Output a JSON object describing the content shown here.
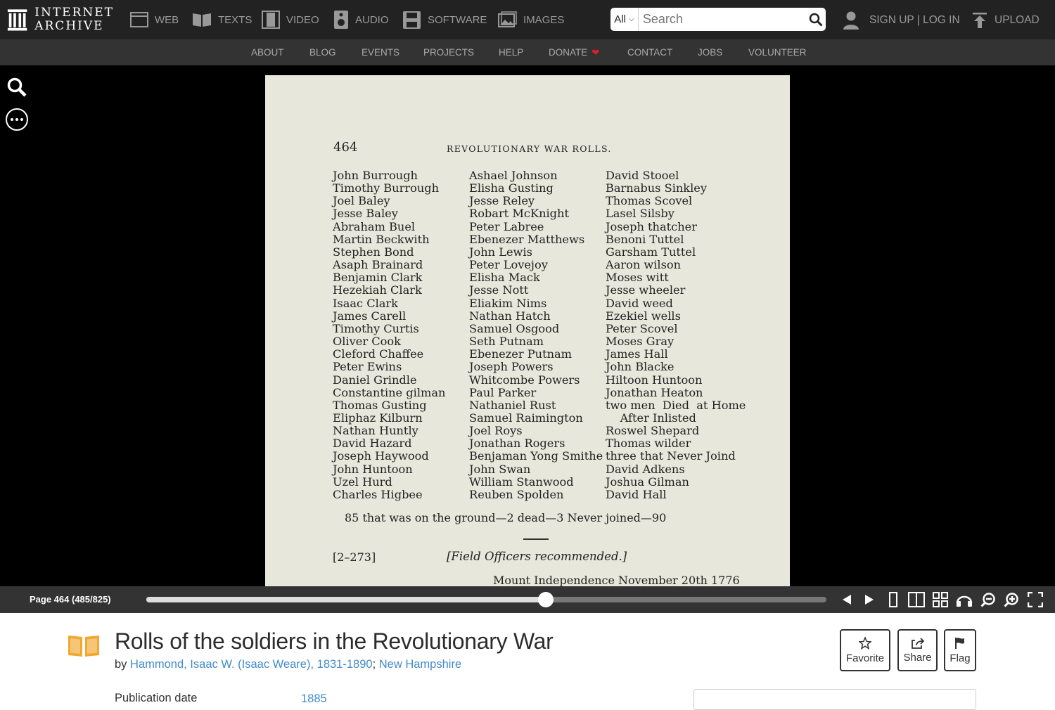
{
  "header": {
    "logo_line1": "INTERNET",
    "logo_line2": "ARCHIVE",
    "media_nav": [
      "WEB",
      "TEXTS",
      "VIDEO",
      "AUDIO",
      "SOFTWARE",
      "IMAGES"
    ],
    "search": {
      "scope": "All",
      "placeholder": "Search"
    },
    "signup_label": "SIGN UP | LOG IN",
    "upload_label": "UPLOAD"
  },
  "subnav": [
    "ABOUT",
    "BLOG",
    "EVENTS",
    "PROJECTS",
    "HELP",
    "DONATE",
    "CONTACT",
    "JOBS",
    "VOLUNTEER"
  ],
  "page": {
    "number": "464",
    "header": "REVOLUTIONARY WAR ROLLS.",
    "col1": [
      "John Burrough",
      "Timothy Burrough",
      "Joel Baley",
      "Jesse Baley",
      "Abraham Buel",
      "Martin Beckwith",
      "Stephen Bond",
      "Asaph Brainard",
      "Benjamin Clark",
      "Hezekiah Clark",
      "Isaac Clark",
      "James Carell",
      "Timothy Curtis",
      "Oliver Cook",
      "Cleford Chaffee",
      "Peter Ewins",
      "Daniel Grindle",
      "Constantine gilman",
      "Thomas Gusting",
      "Eliphaz Kilburn",
      "Nathan Huntly",
      "David Hazard",
      "Joseph Haywood",
      "John Huntoon",
      "Uzel Hurd",
      "Charles Higbee"
    ],
    "col2": [
      "Ashael Johnson",
      "Elisha Gusting",
      "Jesse Reley",
      "Robart McKnight",
      "Peter Labree",
      "Ebenezer Matthews",
      "John Lewis",
      "Peter Lovejoy",
      "Elisha Mack",
      "Jesse Nott",
      "Eliakim Nims",
      "Nathan Hatch",
      "Samuel Osgood",
      "Seth Putnam",
      "Ebenezer Putnam",
      "Joseph Powers",
      "Whitcombe Powers",
      "Paul Parker",
      "Nathaniel Rust",
      "Samuel Raimington",
      "Joel Roys",
      "Jonathan Rogers",
      "Benjaman Yong Smithe",
      "John Swan",
      "William Stanwood",
      "Reuben Spolden"
    ],
    "col3": [
      "David Stooel",
      "Barnabus Sinkley",
      "Thomas Scovel",
      "Lasel Silsby",
      "Joseph thatcher",
      "Benoni Tuttel",
      "Garsham Tuttel",
      "Aaron wilson",
      "Moses witt",
      "Jesse wheeler",
      "David weed",
      "Ezekiel wells",
      "Peter Scovel",
      "Moses Gray",
      "James Hall",
      "John Blacke",
      "Hiltoon Huntoon",
      "Jonathan Heaton",
      "two men  Died  at Home",
      "    After Inlisted",
      "Roswel Shepard",
      "Thomas wilder",
      "three that Never Joind",
      "David Adkens",
      "Joshua Gilman",
      "David Hall"
    ],
    "summary": "85 that was on the ground—2 dead—3 Never joined—90",
    "ref": "[2–273]",
    "ref_title": "[Field Officers recommended.]",
    "dateline": "Mount Independence November 20th 1776"
  },
  "controls": {
    "page_indicator": "Page 464 (485/825)",
    "progress": 0.5879
  },
  "item": {
    "title": "Rolls of the soldiers in the Revolutionary War",
    "by_prefix": "by",
    "author": "Hammond, Isaac W. (Isaac Weare), 1831-1890",
    "separator": ";",
    "place": "New Hampshire",
    "actions": [
      "Favorite",
      "Share",
      "Flag"
    ],
    "pub_label": "Publication date",
    "pub_value": "1885"
  },
  "colors": {
    "topbar": "#222222",
    "subnav": "#333333",
    "page_bg": "#e7e7dc",
    "link": "#428bca",
    "heart": "#e02020",
    "book_icon": "#f0a830"
  }
}
